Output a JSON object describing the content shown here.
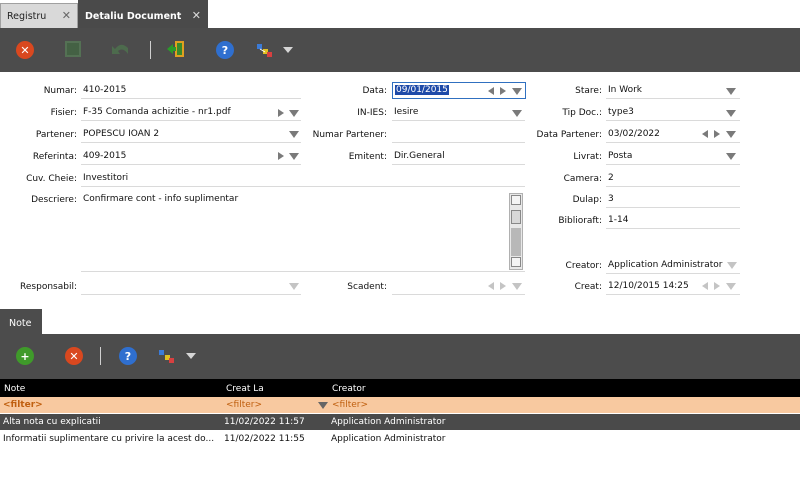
{
  "tabs": [
    {
      "label": "Registru"
    },
    {
      "label": "Detaliu Document"
    }
  ],
  "tab_close_glyph": "✕",
  "form": {
    "numar": {
      "label": "Numar:",
      "value": "410-2015"
    },
    "fisier": {
      "label": "Fisier:",
      "value": "F-35 Comanda achizitie - nr1.pdf"
    },
    "partener": {
      "label": "Partener:",
      "value": "POPESCU IOAN 2"
    },
    "referinta": {
      "label": "Referinta:",
      "value": "409-2015"
    },
    "cuv_cheie": {
      "label": "Cuv. Cheie:",
      "value": "Investitori"
    },
    "descriere": {
      "label": "Descriere:",
      "value": "Confirmare cont  - info suplimentar"
    },
    "responsabil": {
      "label": "Responsabil:",
      "value": ""
    },
    "data": {
      "label": "Data:",
      "value": "09/01/2015"
    },
    "in_ies": {
      "label": "IN-IES:",
      "value": "Iesire"
    },
    "numar_partener": {
      "label": "Numar Partener:",
      "value": ""
    },
    "emitent": {
      "label": "Emitent:",
      "value": "Dir.General"
    },
    "scadent": {
      "label": "Scadent:",
      "value": ""
    },
    "stare": {
      "label": "Stare:",
      "value": "In Work"
    },
    "tip_doc": {
      "label": "Tip Doc.:",
      "value": "type3"
    },
    "data_partener": {
      "label": "Data Partener:",
      "value": "03/02/2022"
    },
    "livrat": {
      "label": "Livrat:",
      "value": "Posta"
    },
    "camera": {
      "label": "Camera:",
      "value": "2"
    },
    "dulap": {
      "label": "Dulap:",
      "value": "3"
    },
    "biblioraft": {
      "label": "Biblioraft:",
      "value": "1-14"
    },
    "creator": {
      "label": "Creator:",
      "value": "Application Administrator"
    },
    "creat": {
      "label": "Creat:",
      "value": "12/10/2015 14:25"
    }
  },
  "note_tab": {
    "label": "Note"
  },
  "grid": {
    "columns": [
      "Note",
      "Creat La",
      "Creator"
    ],
    "filter": [
      "<filter>",
      "<filter>",
      "<filter>"
    ],
    "rows": [
      {
        "note": "Alta nota cu explicatii",
        "creat_la": "11/02/2022 11:57",
        "creator": "Application Administrator"
      },
      {
        "note": "Informatii suplimentare cu privire la acest do...",
        "creat_la": "11/02/2022 11:55",
        "creator": "Application Administrator"
      }
    ]
  },
  "icons": {
    "close": "✕",
    "help": "?",
    "add": "+"
  },
  "colors": {
    "toolbar": "#4c4c4c",
    "filter_row": "#f8c9a0",
    "selected_row": "#4a4a4a",
    "close_red": "#d9481f",
    "help_blue": "#2f6fcf",
    "add_green": "#3f9a2a"
  }
}
